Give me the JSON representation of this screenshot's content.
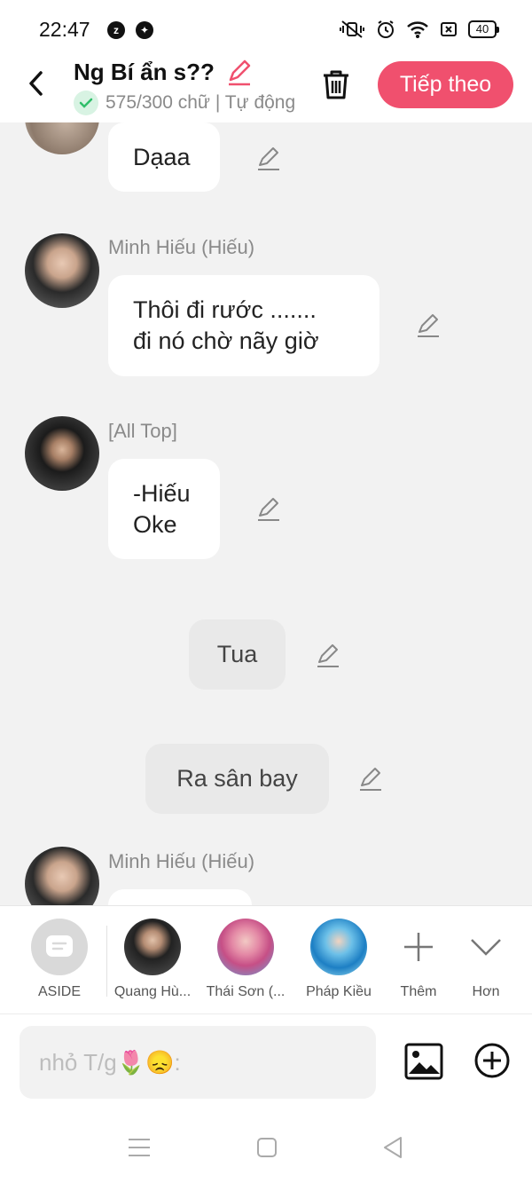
{
  "status_bar": {
    "time": "22:47",
    "battery": "40"
  },
  "header": {
    "title": "Ng Bí ẩn s??",
    "subtitle": "575/300 chữ | Tự động",
    "next_label": "Tiếp theo"
  },
  "messages": [
    {
      "type": "partial",
      "text": "Dạaa"
    },
    {
      "type": "character",
      "sender": "Minh Hiếu (Hiếu)",
      "lines": [
        "Thôi đi rước .......",
        "đi nó chờ nãy giờ"
      ]
    },
    {
      "type": "character",
      "sender": "[All Top]",
      "lines": [
        "-Hiếu",
        "Oke"
      ]
    },
    {
      "type": "narration",
      "text": "Tua"
    },
    {
      "type": "narration",
      "text": "Ra sân bay"
    },
    {
      "type": "character",
      "sender": "Minh Hiếu (Hiếu)",
      "lines": []
    }
  ],
  "characters": [
    {
      "label": "ASIDE"
    },
    {
      "label": "Quang Hù..."
    },
    {
      "label": "Thái Sơn (..."
    },
    {
      "label": "Pháp Kiều"
    },
    {
      "label": "Thêm"
    },
    {
      "label": "Hơn"
    }
  ],
  "input": {
    "placeholder": "nhỏ T/g🌷😞:"
  },
  "colors": {
    "accent": "#f0506e",
    "check": "#2fbf6a",
    "background": "#f2f2f2"
  }
}
